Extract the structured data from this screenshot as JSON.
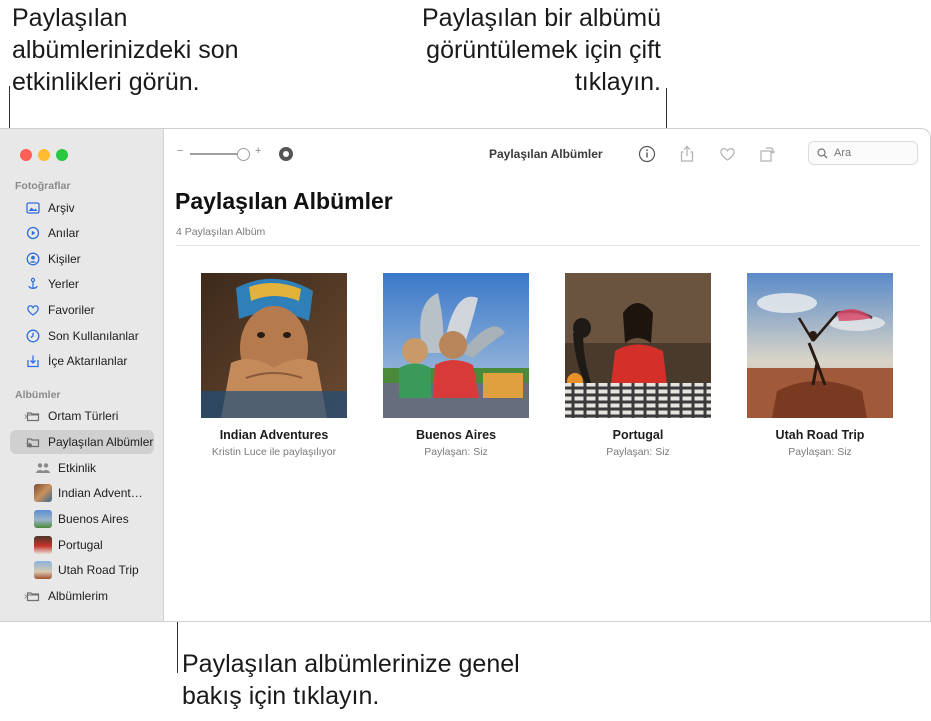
{
  "callouts": {
    "top_left": "Paylaşılan albümlerinizdeki son etkinlikleri görün.",
    "top_right": "Paylaşılan bir albümü görüntülemek için çift tıklayın.",
    "bottom": "Paylaşılan albümlerinize genel bakış için tıklayın."
  },
  "sidebar": {
    "section_photos": "Fotoğraflar",
    "photos_items": [
      {
        "label": "Arşiv",
        "icon": "library-icon"
      },
      {
        "label": "Anılar",
        "icon": "memories-icon"
      },
      {
        "label": "Kişiler",
        "icon": "people-icon"
      },
      {
        "label": "Yerler",
        "icon": "places-icon"
      },
      {
        "label": "Favoriler",
        "icon": "heart-icon"
      },
      {
        "label": "Son Kullanılanlar",
        "icon": "clock-icon"
      },
      {
        "label": "İçe Aktarılanlar",
        "icon": "import-icon"
      }
    ],
    "section_albums": "Albümler",
    "album_items": [
      {
        "label": "Ortam Türleri",
        "icon": "folder-icon"
      },
      {
        "label": "Paylaşılan Albümler",
        "icon": "shared-folder-icon",
        "selected": true
      }
    ],
    "shared_sub_items": [
      {
        "label": "Etkinlik",
        "icon": "activity-icon"
      },
      {
        "label": "Indian Advent…",
        "icon": "album-thumbnail"
      },
      {
        "label": "Buenos Aires",
        "icon": "album-thumbnail"
      },
      {
        "label": "Portugal",
        "icon": "album-thumbnail"
      },
      {
        "label": "Utah Road Trip",
        "icon": "album-thumbnail"
      }
    ],
    "my_albums": "Albümlerim"
  },
  "toolbar": {
    "title": "Paylaşılan Albümler",
    "zoom_minus": "−",
    "zoom_plus": "+",
    "search_placeholder": "Ara"
  },
  "main": {
    "title": "Paylaşılan Albümler",
    "count": "4 Paylaşılan Albüm",
    "albums": [
      {
        "name": "Indian Adventures",
        "shared_by": "Kristin Luce ile paylaşılıyor"
      },
      {
        "name": "Buenos Aires",
        "shared_by": "Paylaşan: Siz"
      },
      {
        "name": "Portugal",
        "shared_by": "Paylaşan: Siz"
      },
      {
        "name": "Utah Road Trip",
        "shared_by": "Paylaşan: Siz"
      }
    ]
  },
  "colors": {
    "close": "#fe5f57",
    "minimize": "#febc2e",
    "maximize": "#28c840",
    "accent": "#2f6fdf",
    "sidebar_bg": "#e8e8e8",
    "selected_bg": "#d0d0d0"
  }
}
